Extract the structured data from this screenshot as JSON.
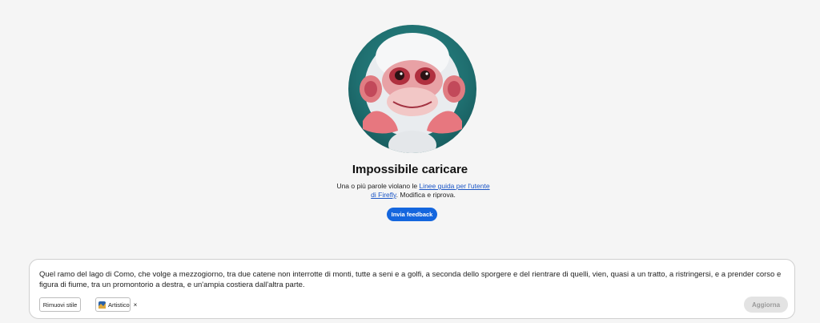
{
  "error": {
    "title": "Impossibile caricare",
    "message_before": "Una o più parole violano le ",
    "guidelines_link": "Linee guida per l'utente di Firefly",
    "message_after": ". Modifica e riprova.",
    "feedback_label": "Invia feedback"
  },
  "prompt": {
    "text": "Quel ramo del lago di Como, che volge a mezzogiorno, tra due catene non interrotte di monti, tutte a seni e a golfi, a seconda dello sporgere e del rientrare di quelli, vien, quasi a un tratto, a ristringersi, e a prender corso e figura di fiume, tra un promontorio a destra, e un'ampia costiera dall'altra parte.",
    "remove_style_label": "Rimuovi stile",
    "style_chip_label": "Artistico",
    "style_chip_close": "×",
    "update_label": "Aggiorna"
  },
  "colors": {
    "accent": "#1466de",
    "background": "#f5f5f5",
    "disabled": "#e3e3e3"
  }
}
